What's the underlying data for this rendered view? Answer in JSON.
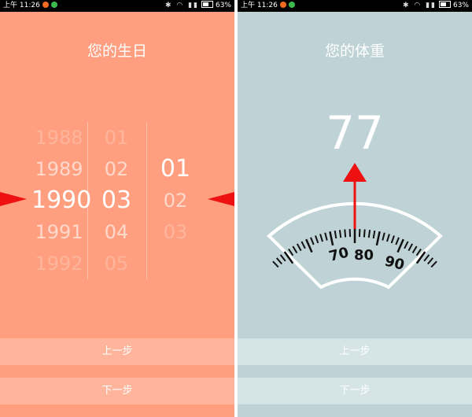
{
  "status_bar": {
    "time_label": "上午 11:26",
    "battery_percent": "63%"
  },
  "birthday_screen": {
    "title": "您的生日",
    "year_column": [
      "1988",
      "1989",
      "1990",
      "1991",
      "1992"
    ],
    "month_column": [
      "01",
      "02",
      "03",
      "04",
      "05"
    ],
    "day_column": [
      "01",
      "02",
      "03"
    ],
    "selected": {
      "year": "1990",
      "month": "03",
      "day": "01"
    },
    "prev_button": "上一步",
    "next_button": "下一步"
  },
  "weight_screen": {
    "title": "您的体重",
    "value": "77",
    "scale_labels": [
      "70",
      "80",
      "90"
    ],
    "prev_button": "上一步",
    "next_button": "下一步"
  },
  "colors": {
    "birthday_bg": "#FF9F80",
    "weight_bg": "#BFD3D6",
    "indicator_red": "#EE1111"
  }
}
